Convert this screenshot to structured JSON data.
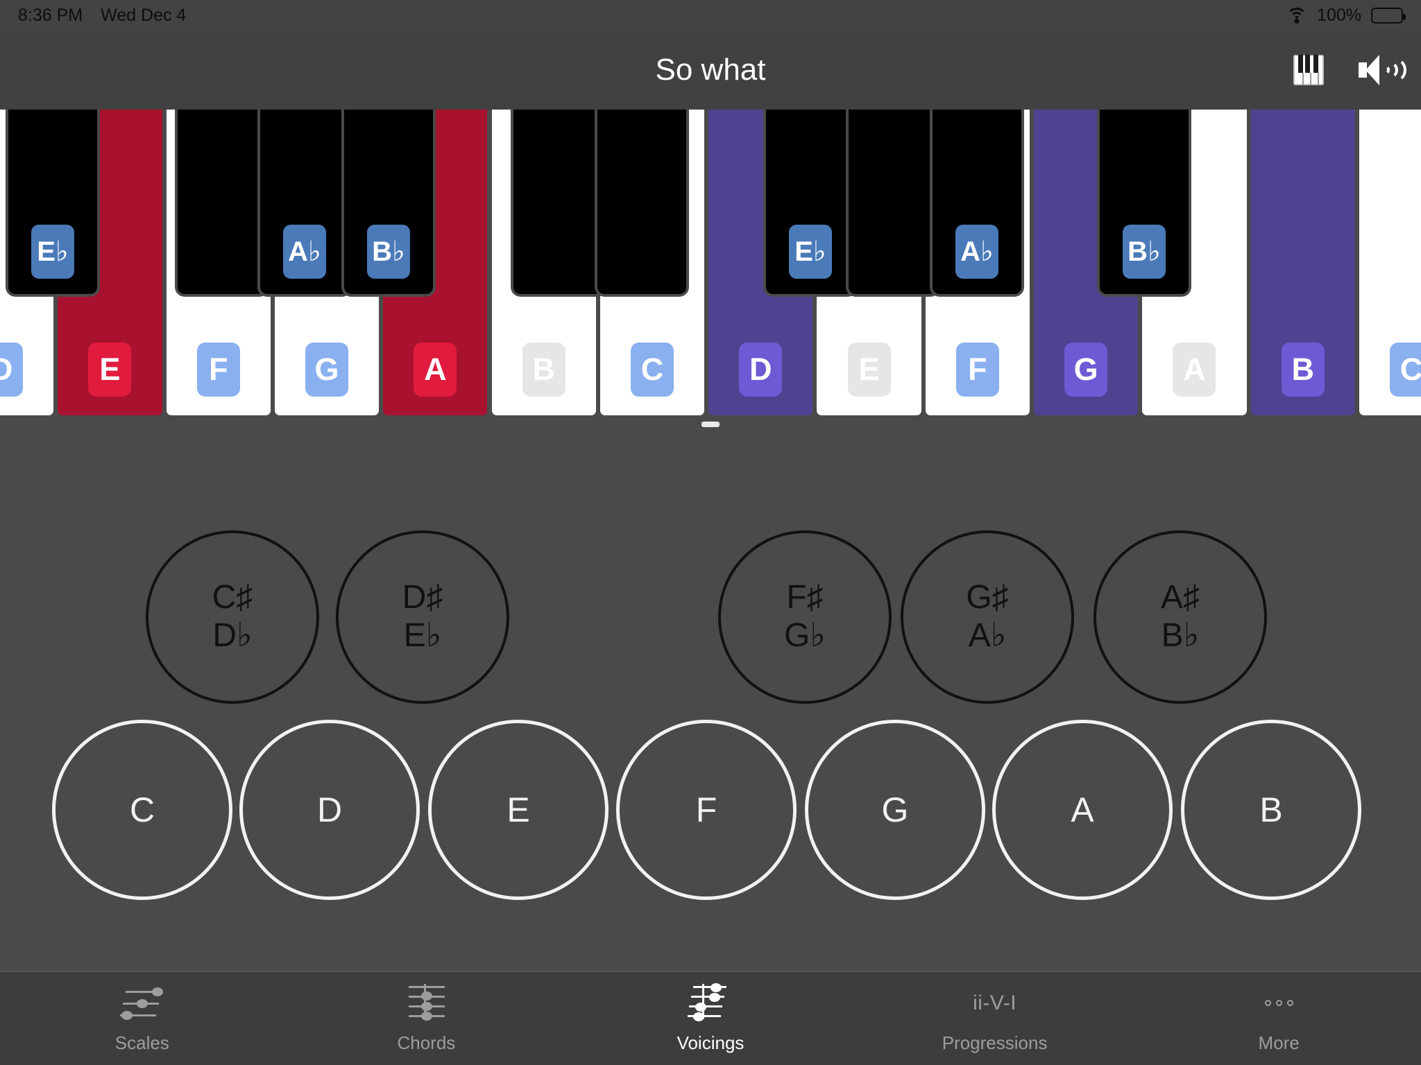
{
  "status_bar": {
    "time": "8:36 PM",
    "date": "Wed Dec 4",
    "battery_percent": "100%",
    "wifi_icon": "wifi-icon",
    "battery_icon": "battery-full-icon"
  },
  "nav": {
    "title": "So what",
    "piano_icon": "piano-keyboard-icon",
    "speaker_icon": "speaker-volume-icon"
  },
  "keyboard": {
    "white_keys": [
      {
        "label": "D",
        "key_state": "normal",
        "badge": "blue",
        "partial": true
      },
      {
        "label": "E",
        "key_state": "red",
        "badge": "red",
        "partial": false
      },
      {
        "label": "F",
        "key_state": "normal",
        "badge": "blue",
        "partial": false
      },
      {
        "label": "G",
        "key_state": "normal",
        "badge": "blue",
        "partial": false
      },
      {
        "label": "A",
        "key_state": "red",
        "badge": "red",
        "partial": false
      },
      {
        "label": "B",
        "key_state": "normal",
        "badge": "gray",
        "partial": false
      },
      {
        "label": "C",
        "key_state": "normal",
        "badge": "blue",
        "partial": false
      },
      {
        "label": "D",
        "key_state": "purple",
        "badge": "purple",
        "partial": false
      },
      {
        "label": "E",
        "key_state": "normal",
        "badge": "gray",
        "partial": false
      },
      {
        "label": "F",
        "key_state": "normal",
        "badge": "blue",
        "partial": false
      },
      {
        "label": "G",
        "key_state": "purple",
        "badge": "purple",
        "partial": false
      },
      {
        "label": "A",
        "key_state": "normal",
        "badge": "gray",
        "partial": false
      },
      {
        "label": "B",
        "key_state": "purple",
        "badge": "purple",
        "partial": false
      },
      {
        "label": "C",
        "key_state": "normal",
        "badge": "blue",
        "partial": true
      }
    ],
    "black_keys": [
      {
        "letter": "E",
        "accidental": "♭",
        "labeled": true
      },
      {
        "letter": "",
        "accidental": "",
        "labeled": false
      },
      {
        "letter": "A",
        "accidental": "♭",
        "labeled": true
      },
      {
        "letter": "B",
        "accidental": "♭",
        "labeled": true
      },
      {
        "letter": "",
        "accidental": "",
        "labeled": false
      },
      {
        "letter": "",
        "accidental": "",
        "labeled": false
      },
      {
        "letter": "E",
        "accidental": "♭",
        "labeled": true
      },
      {
        "letter": "",
        "accidental": "",
        "labeled": false
      },
      {
        "letter": "A",
        "accidental": "♭",
        "labeled": true
      },
      {
        "letter": "B",
        "accidental": "♭",
        "labeled": true
      }
    ],
    "drag_handle": "keyboard-resize-handle"
  },
  "note_selector": {
    "sharp_circles": [
      {
        "sharp": "C♯",
        "flat": "D♭"
      },
      {
        "sharp": "D♯",
        "flat": "E♭"
      },
      {
        "sharp": "F♯",
        "flat": "G♭"
      },
      {
        "sharp": "G♯",
        "flat": "A♭"
      },
      {
        "sharp": "A♯",
        "flat": "B♭"
      }
    ],
    "natural_circles": [
      "C",
      "D",
      "E",
      "F",
      "G",
      "A",
      "B"
    ]
  },
  "tab_bar": {
    "tabs": [
      {
        "label": "Scales",
        "icon": "staff-scale-icon",
        "active": false
      },
      {
        "label": "Chords",
        "icon": "staff-chord-icon",
        "active": false
      },
      {
        "label": "Voicings",
        "icon": "staff-voicing-icon",
        "active": true
      },
      {
        "label": "Progressions",
        "icon": "ii-V-I",
        "active": false
      },
      {
        "label": "More",
        "icon": "ellipsis-icon",
        "active": false
      }
    ]
  },
  "colors": {
    "background": "#4a4a4a",
    "nav_background": "#414141",
    "tab_background": "#3d3d3d",
    "key_red": "#A9122F",
    "key_purple": "#4E4391",
    "badge_blue": "#8AB0F0",
    "badge_gray": "#E6E6E6",
    "badge_red": "#E01B3E",
    "badge_purple": "#6C5BD4",
    "black_key_badge": "#4A7AB8",
    "active_tab": "#ffffff",
    "inactive_tab": "#9d9d9d"
  }
}
